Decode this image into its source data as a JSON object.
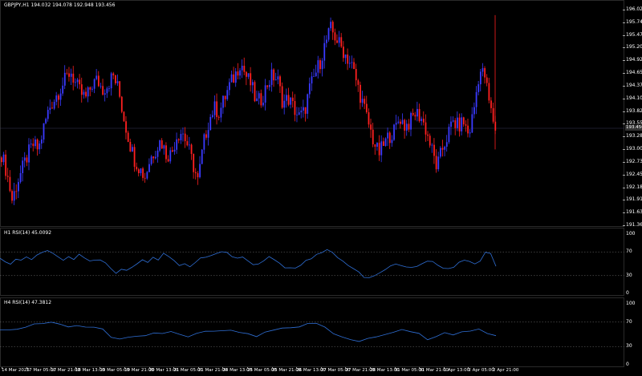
{
  "main": {
    "title": "GBPJPY,H1  194.032 194.078 192.948 193.456",
    "current_price": "193.456",
    "price_labels": [
      "196.020",
      "195.745",
      "195.470",
      "195.200",
      "194.925",
      "194.650",
      "194.375",
      "194.100",
      "193.825",
      "193.550",
      "193.280",
      "193.005",
      "192.730",
      "192.455",
      "192.180",
      "191.910",
      "191.635",
      "191.360"
    ],
    "colors": {
      "bull": "#3a3aff",
      "bear": "#ff2020",
      "grid": "#1e1e1e"
    }
  },
  "rsi1": {
    "title": "H1 RSI(14) 45.0092",
    "labels": [
      "100",
      "70",
      "30",
      "0"
    ],
    "color": "#2f6fd6"
  },
  "rsi2": {
    "title": "H4 RSI(14) 47.3812",
    "labels": [
      "100",
      "70",
      "30",
      "0"
    ],
    "color": "#2f6fd6"
  },
  "time_axis": {
    "labels": [
      "14 Mar 2025",
      "17 Mar 05:00",
      "17 Mar 21:00",
      "18 Mar 13:00",
      "19 Mar 05:00",
      "19 Mar 21:00",
      "20 Mar 13:00",
      "21 Mar 05:00",
      "21 Mar 21:00",
      "24 Mar 13:00",
      "25 Mar 05:00",
      "25 Mar 21:00",
      "26 Mar 13:00",
      "27 Mar 05:00",
      "27 Mar 21:00",
      "28 Mar 13:00",
      "31 Mar 05:00",
      "31 Mar 21:00",
      "1 Apr 13:00",
      "2 Apr 05:00",
      "2 Apr 21:00"
    ]
  },
  "chart_data": [
    {
      "type": "candlestick",
      "title": "GBPJPY,H1  194.032 194.078 192.948 193.456",
      "ylim": [
        191.36,
        196.02
      ],
      "note_series": "approximate path of closes",
      "closes": [
        192.9,
        192.5,
        191.9,
        192.3,
        192.6,
        192.9,
        193.1,
        193.0,
        193.5,
        193.9,
        194.1,
        194.3,
        194.5,
        194.7,
        194.4,
        194.2,
        194.1,
        194.4,
        194.5,
        194.3,
        194.4,
        194.6,
        194.3,
        193.7,
        193.2,
        192.8,
        192.6,
        192.4,
        192.8,
        193.0,
        193.2,
        192.9,
        192.9,
        193.3,
        193.4,
        193.1,
        192.7,
        192.3,
        193.1,
        193.6,
        193.9,
        193.8,
        194.1,
        194.4,
        194.6,
        194.9,
        194.6,
        194.4,
        194.0,
        194.1,
        194.4,
        194.6,
        194.5,
        194.0,
        194.1,
        193.9,
        193.7,
        193.8,
        194.3,
        194.6,
        194.9,
        195.3,
        195.6,
        195.4,
        195.2,
        195.0,
        194.8,
        194.4,
        194.0,
        193.6,
        193.2,
        192.9,
        193.1,
        193.3,
        193.4,
        193.7,
        193.5,
        193.6,
        193.8,
        193.7,
        193.4,
        193.0,
        192.6,
        193.0,
        193.3,
        193.6,
        193.5,
        193.6,
        193.3,
        193.9,
        194.7,
        194.6,
        193.9,
        193.46
      ]
    },
    {
      "type": "line",
      "title": "H1 RSI(14) 45.0092",
      "ylim": [
        0,
        100
      ],
      "values": [
        60,
        52,
        48,
        58,
        55,
        62,
        57,
        65,
        70,
        72,
        68,
        60,
        55,
        62,
        58,
        66,
        60,
        56,
        55,
        58,
        52,
        42,
        35,
        40,
        38,
        45,
        50,
        55,
        52,
        60,
        58,
        66,
        62,
        55,
        48,
        52,
        45,
        50,
        58,
        60,
        62,
        66,
        70,
        68,
        62,
        58,
        60,
        55,
        50,
        48,
        56,
        62,
        58,
        50,
        45,
        42,
        44,
        48,
        55,
        60,
        66,
        70,
        72,
        68,
        60,
        55,
        48,
        42,
        35,
        28,
        25,
        30,
        35,
        40,
        45,
        50,
        48,
        45,
        44,
        46,
        50,
        55,
        52,
        48,
        42,
        40,
        46,
        52,
        56,
        54,
        50,
        56,
        70,
        68,
        45
      ]
    },
    {
      "type": "line",
      "title": "H4 RSI(14) 47.3812",
      "ylim": [
        0,
        100
      ],
      "values": [
        58,
        56,
        57,
        62,
        66,
        68,
        70,
        67,
        63,
        64,
        62,
        60,
        58,
        45,
        43,
        45,
        47,
        49,
        51,
        53,
        55,
        50,
        47,
        51,
        54,
        56,
        56,
        55,
        53,
        50,
        48,
        52,
        57,
        60,
        62,
        64,
        68,
        66,
        60,
        50,
        44,
        40,
        38,
        42,
        46,
        48,
        52,
        58,
        56,
        50,
        42,
        46,
        54,
        48,
        56,
        54,
        60,
        52,
        47
      ]
    }
  ]
}
